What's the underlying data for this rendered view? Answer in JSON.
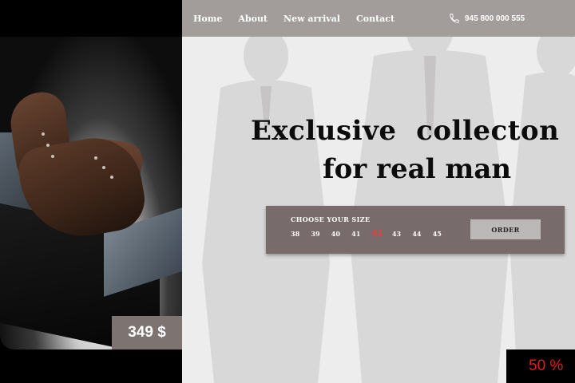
{
  "nav": {
    "items": [
      {
        "label": "Home"
      },
      {
        "label": "About"
      },
      {
        "label": "New arrival"
      },
      {
        "label": "Contact"
      }
    ],
    "phone": "945 800 000 555"
  },
  "hero": {
    "line1": "Exclusive  collecton",
    "line2": "for real man"
  },
  "product": {
    "price": "349 $"
  },
  "size_picker": {
    "title": "CHOOSE YOUR SIZE",
    "sizes": [
      "38",
      "39",
      "40",
      "41",
      "42",
      "43",
      "44",
      "45"
    ],
    "selected": "42",
    "order_label": "ORDER"
  },
  "promo": {
    "discount": "50 %"
  },
  "colors": {
    "navbar": "#a29c9b",
    "panel": "#776c6b",
    "accent": "#e2443b",
    "background": "#eeeded"
  }
}
